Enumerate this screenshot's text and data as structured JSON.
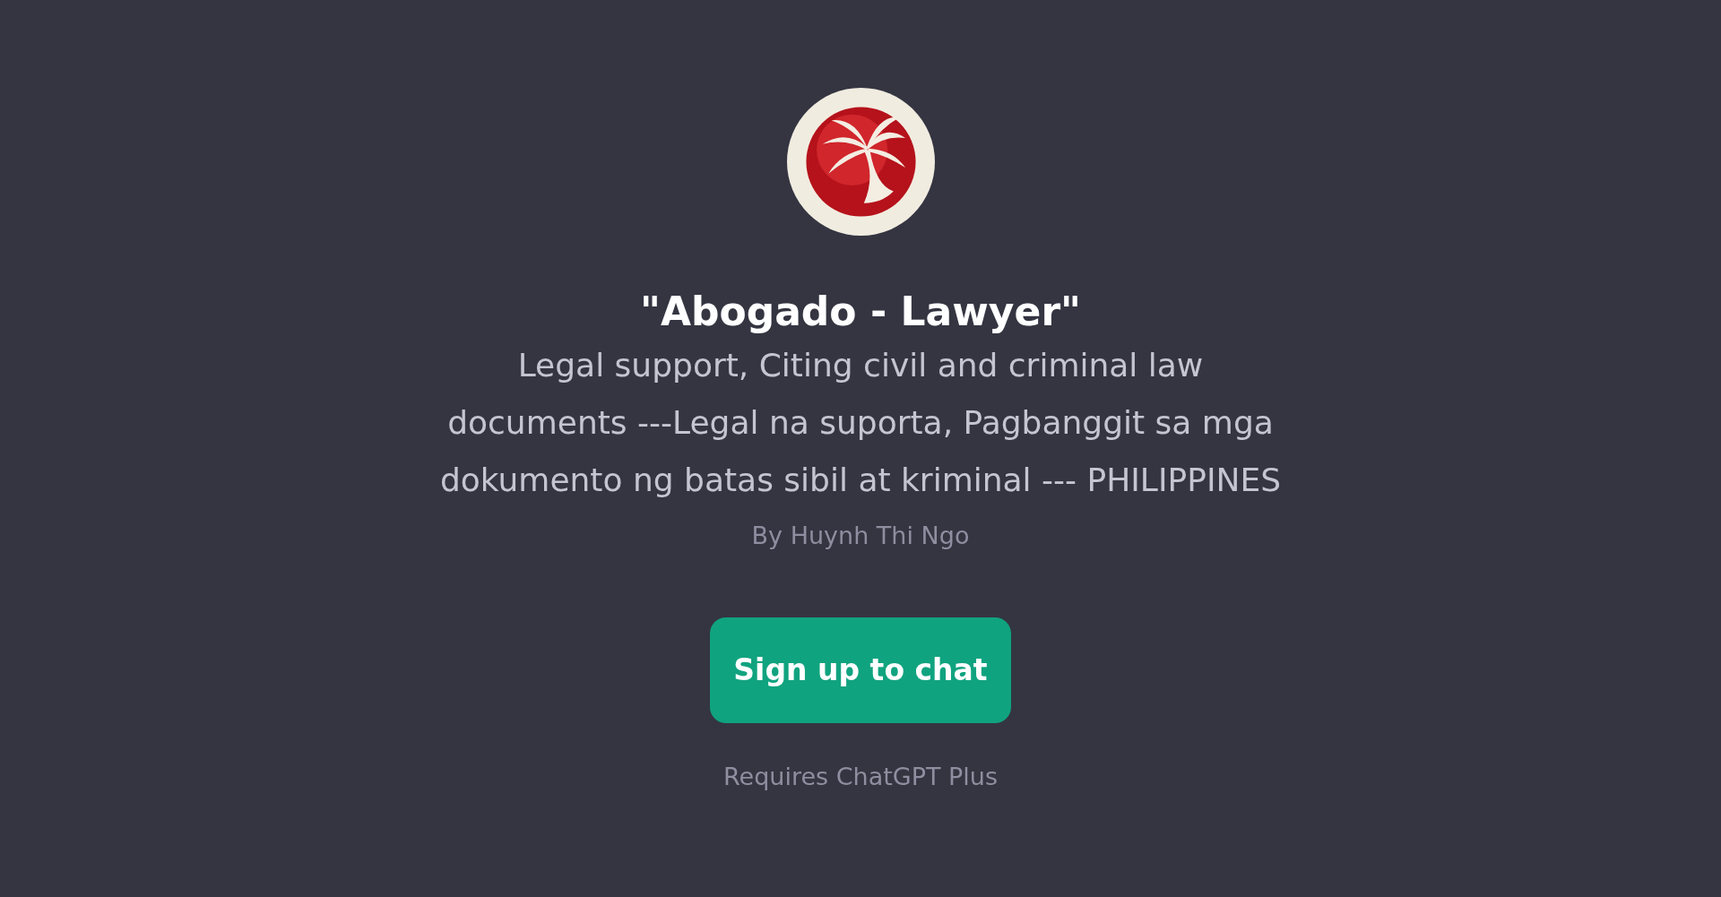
{
  "gpt": {
    "title": "\"Abogado - Lawyer\"",
    "description": "Legal support, Citing civil and criminal law documents ---Legal na suporta, Pagbanggit sa mga dokumento ng batas sibil at kriminal --- PHILIPPINES",
    "author": "By Huynh Thi Ngo"
  },
  "signup_button": "Sign up to chat",
  "footnote": "Requires ChatGPT Plus"
}
